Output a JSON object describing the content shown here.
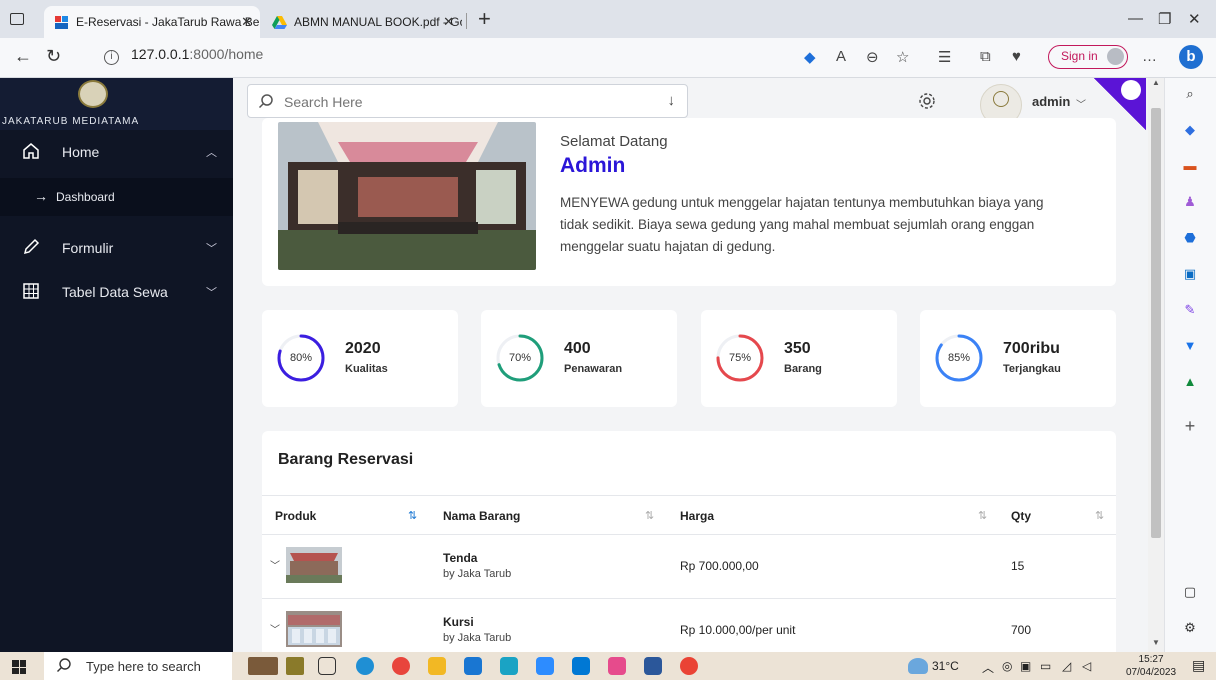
{
  "browser": {
    "tabs": [
      {
        "title": "E-Reservasi - JakaTarub Rawa Ber",
        "active": true
      },
      {
        "title": "ABMN MANUAL BOOK.pdf - Goo",
        "active": false
      }
    ],
    "url_host": "127.0.0.1",
    "url_rest": ":8000/home",
    "signin_label": "Sign in"
  },
  "sidebar": {
    "logo_text": "JAKATARUB MEDIATAMA",
    "items": [
      {
        "label": "Home"
      },
      {
        "label": "Formulir"
      },
      {
        "label": "Tabel Data Sewa"
      }
    ],
    "sub_items": [
      {
        "label": "Dashboard"
      }
    ]
  },
  "topbar": {
    "search_placeholder": "Search Here",
    "user_name": "admin"
  },
  "welcome": {
    "greeting": "Selamat Datang",
    "name": "Admin",
    "description": "MENYEWA gedung untuk menggelar hajatan tentunya membutuhkan biaya yang tidak sedikit. Biaya sewa gedung yang mahal membuat sejumlah orang enggan menggelar suatu hajatan di gedung."
  },
  "stats": [
    {
      "percent": 80,
      "percent_label": "80%",
      "value": "2020",
      "caption": "Kualitas",
      "color": "#3b1ee0",
      "color2": "#9b8cff"
    },
    {
      "percent": 70,
      "percent_label": "70%",
      "value": "400",
      "caption": "Penawaran",
      "color": "#1f9e7a",
      "color2": "#7fd1b8"
    },
    {
      "percent": 75,
      "percent_label": "75%",
      "value": "350",
      "caption": "Barang",
      "color": "#e5484d",
      "color2": "#f7a3a6"
    },
    {
      "percent": 85,
      "percent_label": "85%",
      "value": "700ribu",
      "caption": "Terjangkau",
      "color": "#3b82f6",
      "color2": "#a6c8ff"
    }
  ],
  "reservation": {
    "title": "Barang Reservasi",
    "columns": [
      "Produk",
      "Nama Barang",
      "Harga",
      "Qty"
    ],
    "rows": [
      {
        "name": "Tenda",
        "by": "by Jaka Tarub",
        "price": "Rp 700.000,00",
        "qty": "15"
      },
      {
        "name": "Kursi",
        "by": "by Jaka Tarub",
        "price": "Rp 10.000,00/per unit",
        "qty": "700"
      }
    ]
  },
  "taskbar": {
    "search_text": "Type here to search",
    "temperature": "31°C",
    "time": "15:27",
    "date": "07/04/2023"
  }
}
